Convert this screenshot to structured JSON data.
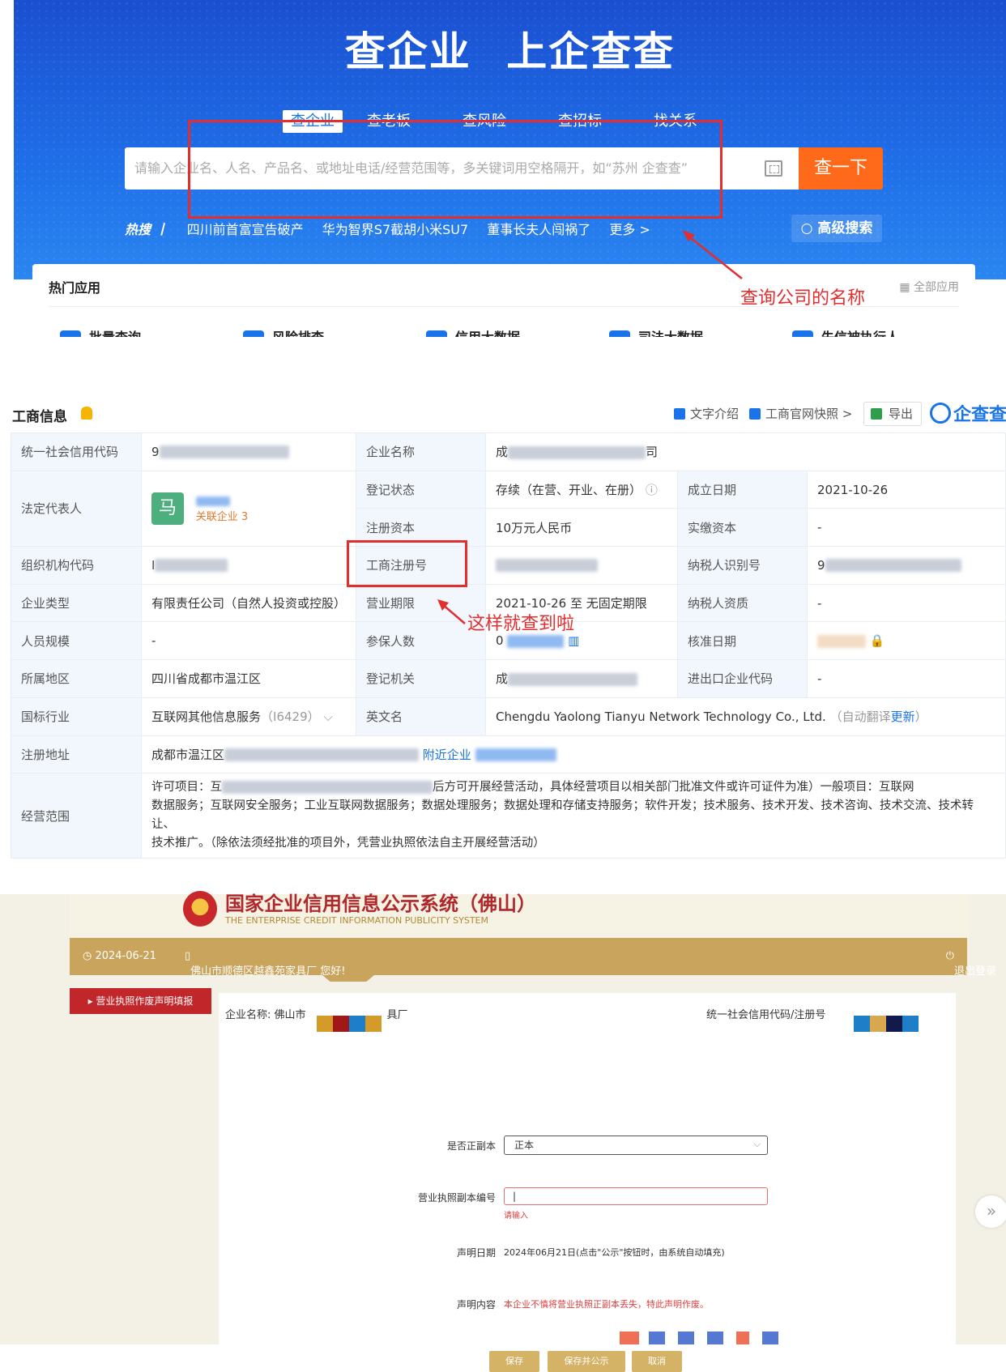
{
  "hero": {
    "title": "查企业  上企查查",
    "tabs": [
      "查企业",
      "查老板",
      "查风险",
      "查招标",
      "找关系"
    ],
    "search_placeholder": "请输入企业名、人名、产品名、或地址电话/经营范围等，多关键词用空格隔开，如“苏州 企查查”",
    "search_button": "查一下",
    "hot_label": "热搜 丨",
    "hot_items": [
      "四川前首富宣告破产",
      "华为智界S7截胡小米SU7",
      "董事长夫人闯祸了",
      "更多 >"
    ],
    "advanced_search": "高级搜索",
    "annotation": "查询公司的名称",
    "colors": {
      "hero_blue": "#1f6fe8",
      "search_button": "#ff6a1a",
      "annotation_red": "#e42d2d"
    }
  },
  "apps": {
    "title": "热门应用",
    "all_apps": "全部应用",
    "items": [
      "批量查询",
      "风险排查",
      "信用大数据",
      "司法大数据",
      "失信被执行人"
    ]
  },
  "business_info": {
    "title": "工商信息",
    "header_links": [
      "文字介绍",
      "工商官网快照 >",
      "导出"
    ],
    "logo": "企查查",
    "annotation": "这样就查到啦",
    "rows": {
      "uscc_label": "统一社会信用代码",
      "uscc_prefix": "9",
      "company_name_label": "企业名称",
      "company_name_prefix": "成",
      "company_name_suffix": "司",
      "legal_rep_label": "法定代表人",
      "avatar_char": "马",
      "related": "关联企业 3",
      "reg_status_label": "登记状态",
      "reg_status": "存续（在营、开业、在册）",
      "est_date_label": "成立日期",
      "est_date": "2021-10-26",
      "reg_capital_label": "注册资本",
      "reg_capital": "10万元人民币",
      "paid_capital_label": "实缴资本",
      "paid_capital": "-",
      "org_code_label": "组织机构代码",
      "org_code_prefix": "I",
      "reg_no_label": "工商注册号",
      "taxpayer_id_label": "纳税人识别号",
      "taxpayer_id_prefix": "9",
      "company_type_label": "企业类型",
      "company_type": "有限责任公司（自然人投资或控股）",
      "term_label": "营业期限",
      "term": "2021-10-26 至 无固定期限",
      "taxpayer_qual_label": "纳税人资质",
      "taxpayer_qual": "-",
      "staff_label": "人员规模",
      "staff": "-",
      "insured_label": "参保人数",
      "insured_prefix": "0",
      "approve_date_label": "核准日期",
      "region_label": "所属地区",
      "region": "四川省成都市温江区",
      "authority_label": "登记机关",
      "authority_prefix": "成",
      "import_export_label": "进出口企业代码",
      "import_export": "-",
      "industry_label": "国标行业",
      "industry": "互联网其他信息服务",
      "industry_code": "（I6429）",
      "english_label": "英文名",
      "english": "Chengdu Yaolong Tianyu Network Technology Co., Ltd.",
      "english_note": "（自动翻译",
      "english_update": "更新",
      "english_close": "）",
      "address_label": "注册地址",
      "address_prefix": "成都市温江区",
      "nearby": "附近企业",
      "scope_label": "经营范围",
      "scope_line1": "许可项目：互",
      "scope_line1b": "后方可开展经营活动，具体经营项目以相关部门批准文件或许可证件为准）一般项目：互联网",
      "scope_line2": "数据服务；互联网安全服务；工业互联网数据服务；数据处理服务；数据处理和存储支持服务；软件开发；技术服务、技术开发、技术咨询、技术交流、技术转让、",
      "scope_line3": "技术推广。（除依法须经批准的项目外，凭营业执照依法自主开展经营活动）"
    }
  },
  "gov_system": {
    "title": "国家企业信用信息公示系统（佛山）",
    "subtitle": "THE ENTERPRISE CREDIT INFORMATION PUBLICITY SYSTEM",
    "date": "◷ 2024-06-21",
    "greeting": "佛山市顺德区越鑫苑家具厂 您好!",
    "logout": "退出登录",
    "side_menu": "▸ 营业执照作废声明填报",
    "company_label": "企业名称: 佛山市",
    "company_suffix": "具厂",
    "uscc_label": "统一社会信用代码/注册号",
    "copy_type_label": "是否正副本",
    "copy_type_value": "正本",
    "license_no_label": "营业执照副本编号",
    "license_hint": "请输入",
    "decl_date_label": "声明日期",
    "decl_date_value": "2024年06月21日(点击\"公示\"按钮时，由系统自动填充)",
    "decl_content_label": "声明内容",
    "decl_content_value": "本企业不慎将营业执照正副本丢失，特此声明作废。",
    "buttons": [
      "保存",
      "保存并公示",
      "取消"
    ],
    "colors": {
      "gold": "#c9a45c",
      "red": "#c0262a"
    }
  }
}
